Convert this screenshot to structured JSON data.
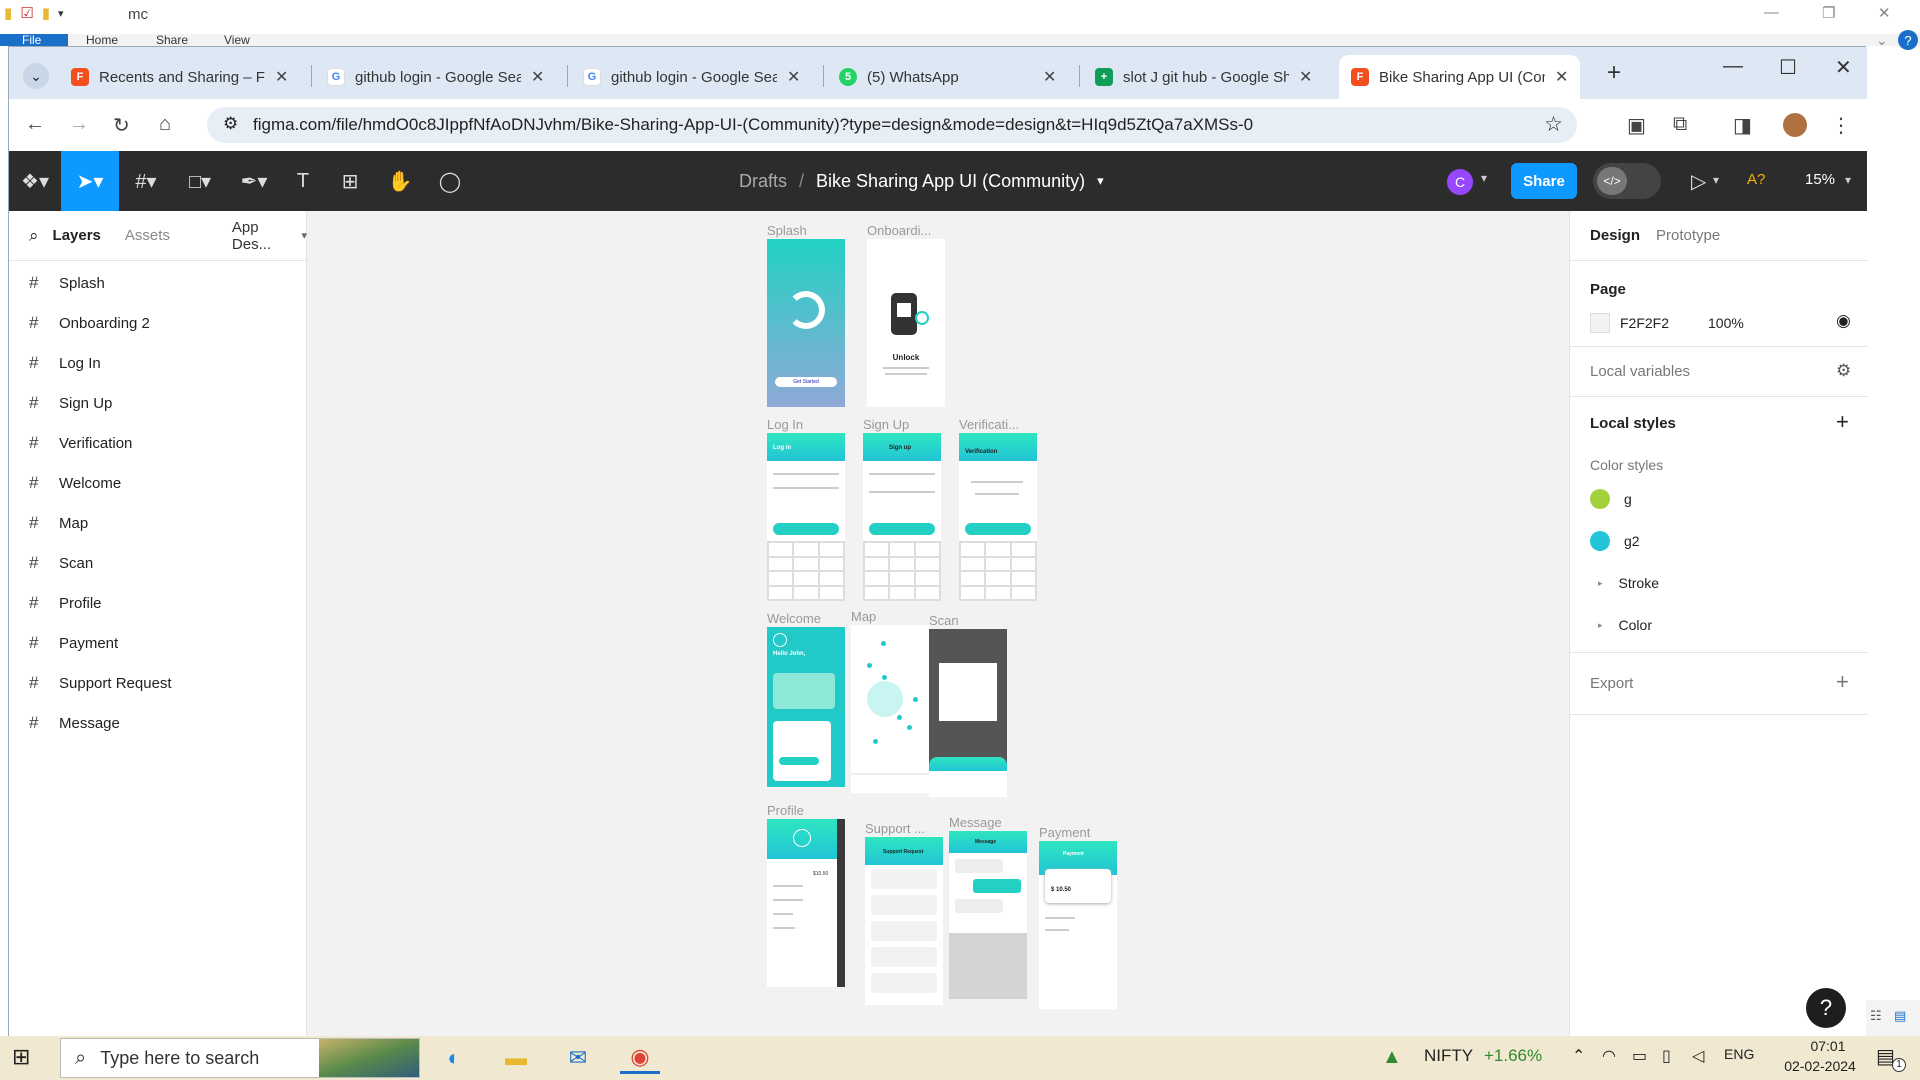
{
  "explorer": {
    "title": "mc",
    "ribbon": [
      "File",
      "Home",
      "Share",
      "View"
    ]
  },
  "chrome": {
    "tabs": [
      {
        "title": "Recents and Sharing – Fig",
        "favicon": "figma-icon",
        "color": "#f24e1e",
        "active": false
      },
      {
        "title": "github login - Google Sea",
        "favicon": "google-icon",
        "color": "#4285f4",
        "active": false
      },
      {
        "title": "github login - Google Sea",
        "favicon": "google-icon",
        "color": "#4285f4",
        "active": false
      },
      {
        "title": "(5) WhatsApp",
        "favicon": "whatsapp-icon",
        "color": "#25d366",
        "active": false
      },
      {
        "title": "slot J git hub - Google Sh",
        "favicon": "sheets-icon",
        "color": "#0f9d58",
        "active": false
      },
      {
        "title": "Bike Sharing App UI (Com",
        "favicon": "figma-icon",
        "color": "#f24e1e",
        "active": true
      }
    ],
    "url": "figma.com/file/hmdO0c8JIppfNfAoDNJvhm/Bike-Sharing-App-UI-(Community)?type=design&mode=design&t=HIq9d5ZtQa7aXMSs-0"
  },
  "figma": {
    "breadcrumb_drafts": "Drafts",
    "breadcrumb_sep": "/",
    "file_name": "Bike Sharing App UI (Community)",
    "avatar_initial": "C",
    "share_label": "Share",
    "ai_label": "A?",
    "zoom": "15%",
    "accent": "#0d99ff"
  },
  "left_panel": {
    "tab_layers": "Layers",
    "tab_assets": "Assets",
    "page_selector": "App Des...",
    "layers": [
      "Splash",
      "Onboarding 2",
      "Log In",
      "Sign Up",
      "Verification",
      "Welcome",
      "Map",
      "Scan",
      "Profile",
      "Payment",
      "Support Request",
      "Message"
    ]
  },
  "canvas": {
    "frames": {
      "splash": "Splash",
      "onboarding": "Onboardi...",
      "login": "Log In",
      "signup": "Sign Up",
      "verification": "Verificati...",
      "welcome": "Welcome",
      "map": "Map",
      "scan": "Scan",
      "profile": "Profile",
      "support": "Support ...",
      "message": "Message",
      "payment": "Payment"
    },
    "splash_button": "Get Started",
    "onboarding_title": "Unlock",
    "login_title": "Log in",
    "signup_title": "Sign up",
    "verification_title": "Verification",
    "welcome_greeting": "Hello John,",
    "support_title": "Support Request",
    "message_title": "Message",
    "payment_title": "Payment",
    "payment_balance": "$ 10.50",
    "profile_amount": "$10.50"
  },
  "right_panel": {
    "tab_design": "Design",
    "tab_prototype": "Prototype",
    "page_heading": "Page",
    "page_color": "F2F2F2",
    "page_opacity": "100%",
    "local_variables": "Local variables",
    "local_styles": "Local styles",
    "color_styles": "Color styles",
    "styles": [
      {
        "name": "g",
        "color": "#a3d13b"
      },
      {
        "name": "g2",
        "color": "#22c4d6"
      }
    ],
    "stroke": "Stroke",
    "color": "Color",
    "export": "Export"
  },
  "taskbar": {
    "search_placeholder": "Type here to search",
    "stock_name": "NIFTY",
    "stock_change": "+1.66%",
    "language": "ENG",
    "time": "07:01",
    "date": "02-02-2024",
    "notification_count": "1"
  }
}
